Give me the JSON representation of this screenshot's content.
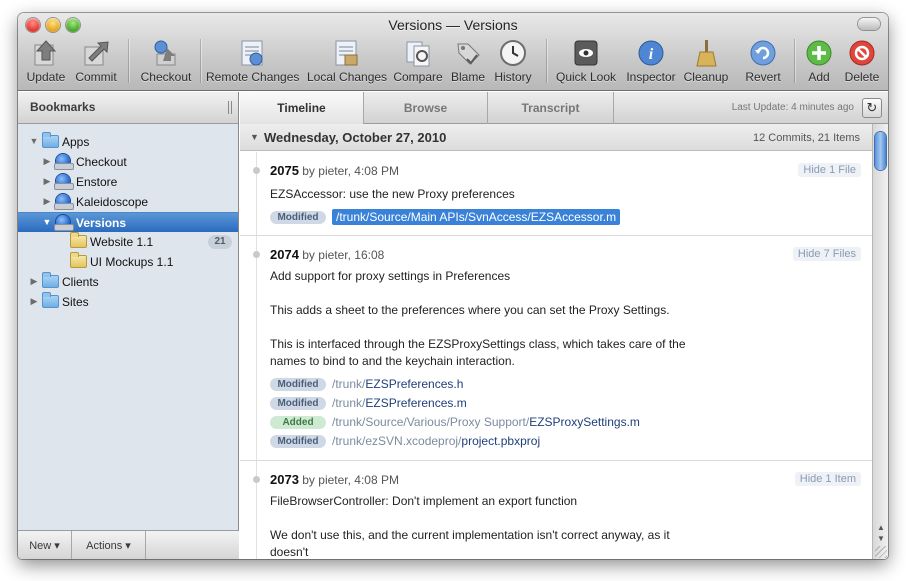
{
  "window": {
    "title": "Versions — Versions"
  },
  "toolbar": {
    "update": "Update",
    "commit": "Commit",
    "checkout": "Checkout",
    "remote_changes": "Remote Changes",
    "local_changes": "Local Changes",
    "compare": "Compare",
    "blame": "Blame",
    "history": "History",
    "quick_look": "Quick Look",
    "inspector": "Inspector",
    "cleanup": "Cleanup",
    "revert": "Revert",
    "add": "Add",
    "delete": "Delete"
  },
  "sidebar": {
    "header": "Bookmarks",
    "items": [
      {
        "label": "Apps"
      },
      {
        "label": "Checkout"
      },
      {
        "label": "Enstore"
      },
      {
        "label": "Kaleidoscope"
      },
      {
        "label": "Versions"
      },
      {
        "label": "Website 1.1",
        "badge": "21"
      },
      {
        "label": "UI Mockups 1.1"
      },
      {
        "label": "Clients"
      },
      {
        "label": "Sites"
      }
    ],
    "footer": {
      "new": "New ▾",
      "actions": "Actions ▾"
    }
  },
  "tabs": {
    "timeline": "Timeline",
    "browse": "Browse",
    "transcript": "Transcript"
  },
  "last_update": "Last Update: 4 minutes ago",
  "day": {
    "title": "Wednesday, October 27, 2010",
    "count": "12 Commits, 21 Items"
  },
  "commits": [
    {
      "rev": "2075",
      "author": " by pieter, 4:08 PM",
      "hide": "Hide 1 File",
      "lines": [
        "EZSAccessor: use the new Proxy preferences"
      ],
      "files": [
        {
          "status": "Modified",
          "dir": "/trunk/Source/Main APIs/SvnAccess/",
          "file": "EZSAccessor.m"
        }
      ]
    },
    {
      "rev": "2074",
      "author": " by pieter, 16:08",
      "hide": "Hide 7 Files",
      "lines": [
        "Add support for proxy settings in Preferences",
        "This adds a sheet to the preferences where you can set the Proxy Settings.",
        "This is interfaced through the EZSProxySettings class, which takes care of the",
        "names to bind to and the keychain interaction."
      ],
      "files": [
        {
          "status": "Modified",
          "dir": "/trunk/",
          "file": "EZSPreferences.h"
        },
        {
          "status": "Modified",
          "dir": "/trunk/",
          "file": "EZSPreferences.m"
        },
        {
          "status": "Added",
          "dir": "/trunk/Source/Various/Proxy Support/",
          "file": "EZSProxySettings.m"
        },
        {
          "status": "Modified",
          "dir": "/trunk/ezSVN.xcodeproj/",
          "file": "project.pbxproj"
        }
      ]
    },
    {
      "rev": "2073",
      "author": " by pieter, 4:08 PM",
      "hide": "Hide 1 Item",
      "lines": [
        "FileBrowserController: Don't implement an export function",
        "We don't use this, and the current implementation isn't correct anyway, as it",
        "doesn't"
      ],
      "files": []
    }
  ]
}
